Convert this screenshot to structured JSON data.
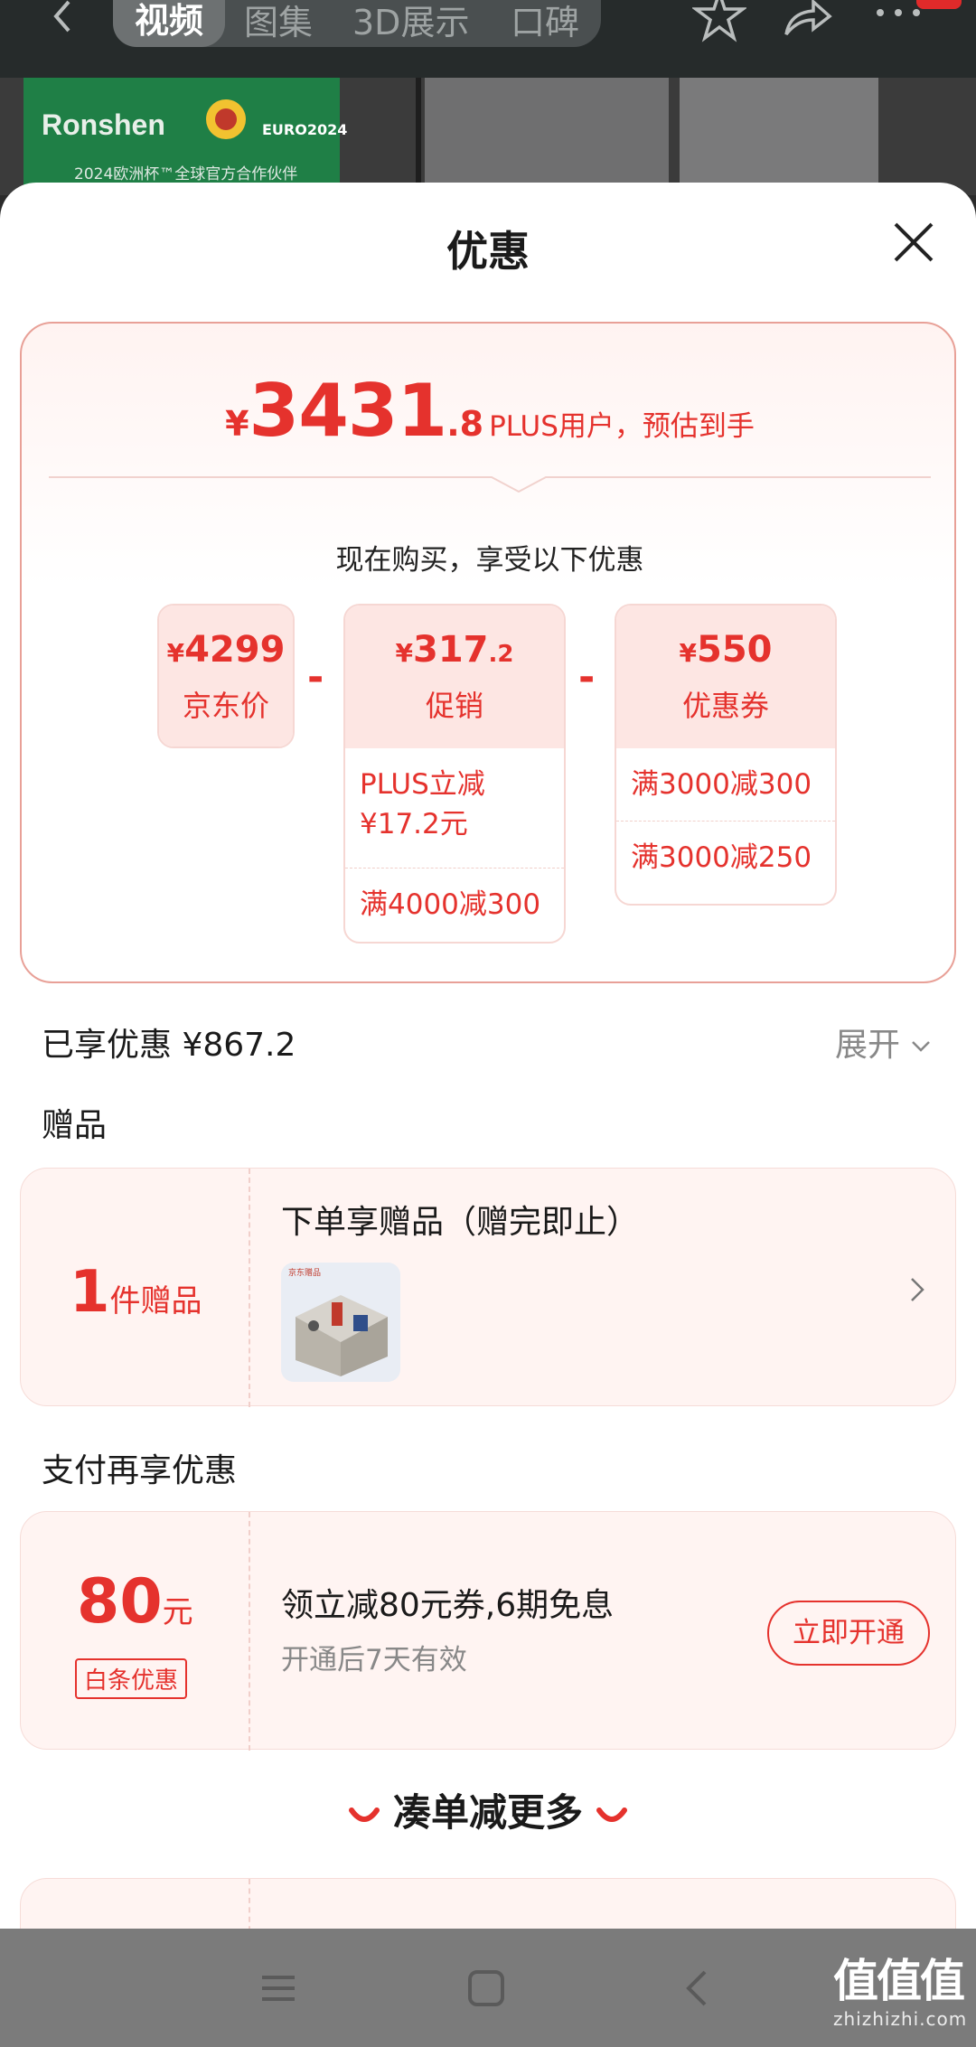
{
  "topbar": {
    "tabs": [
      {
        "label": "视频",
        "active": true
      },
      {
        "label": "图集",
        "active": false
      },
      {
        "label": "3D展示",
        "active": false
      },
      {
        "label": "口碑",
        "active": false
      }
    ]
  },
  "hero": {
    "brand": "Ronshen",
    "euro_text": "EURO2024",
    "subtitle": "2024欧洲杯™全球官方合作伙伴"
  },
  "sheet": {
    "title": "优惠",
    "estimate": {
      "yen": "¥",
      "integer": "3431",
      "decimal": ".8",
      "label": "PLUS用户，预估到手"
    },
    "now_buy_text": "现在购买，享受以下优惠",
    "breakdown": {
      "jd_price": {
        "amount": "4299",
        "caption": "京东价"
      },
      "promo": {
        "amount": "317",
        "decimal": ".2",
        "caption": "促销",
        "lines": [
          "PLUS立减\n¥17.2元",
          "满4000减300"
        ]
      },
      "coupon": {
        "amount": "550",
        "caption": "优惠券",
        "lines": [
          "满3000减300",
          "满3000减250"
        ]
      },
      "yen": "¥",
      "minus": "-"
    },
    "enjoyed": "已享优惠 ¥867.2",
    "expand_label": "展开",
    "gift_section": "赠品",
    "gift": {
      "count": "1",
      "count_suffix": "件赠品",
      "title": "下单享赠品（赠完即止）",
      "thumb_text": "京东赠品"
    },
    "pay_section": "支付再享优惠",
    "pay": {
      "amount": "80",
      "unit": "元",
      "tag": "白条优惠",
      "title": "领立减80元券,6期免息",
      "subtitle": "开通后7天有效",
      "button": "立即开通"
    },
    "more": "凑单减更多"
  },
  "watermark": {
    "logo": "值值值",
    "url": "zhizhizhi.com"
  },
  "colors": {
    "accent": "#e5322d",
    "card_bg": "#fff4f2",
    "nav_bg": "#7b7b7b"
  }
}
